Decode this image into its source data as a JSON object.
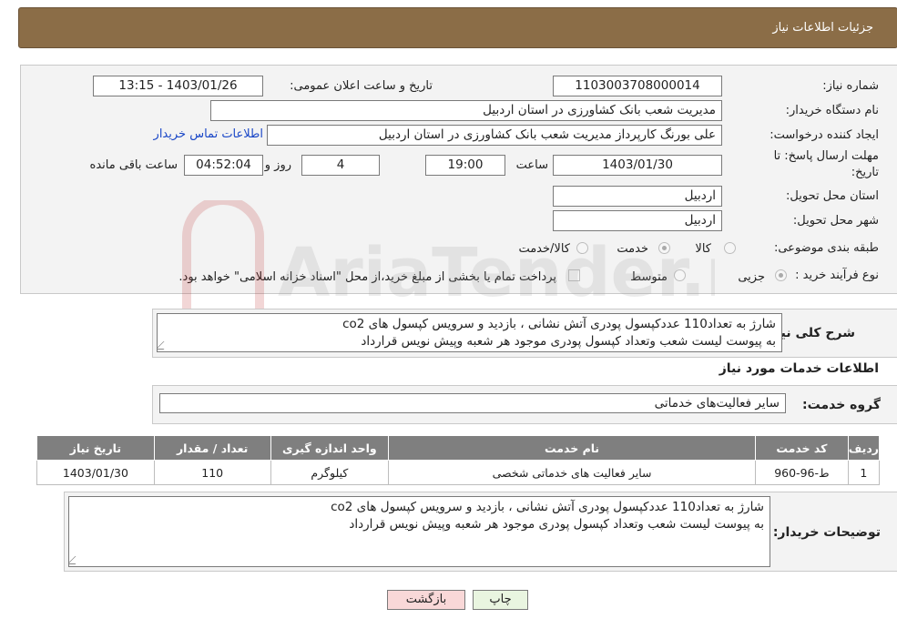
{
  "header": {
    "title": "جزئیات اطلاعات نیاز"
  },
  "form": {
    "need_number_label": "شماره نیاز:",
    "need_number": "1103003708000014",
    "announce_label": "تاریخ و ساعت اعلان عمومی:",
    "announce_value": "1403/01/26 - 13:15",
    "buyer_label": "نام دستگاه خریدار:",
    "buyer_value": "مدیریت شعب بانک کشاورزی در استان اردبیل",
    "creator_label": "ایجاد کننده درخواست:",
    "creator_value": "علی بورنگ کارپرداز مدیریت شعب بانک کشاورزی در استان اردبیل",
    "contact_link": "اطلاعات تماس خریدار",
    "deadline_label_1": "مهلت ارسال پاسخ: تا",
    "deadline_label_2": "تاریخ:",
    "deadline_date": "1403/01/30",
    "time_label": "ساعت",
    "deadline_time": "19:00",
    "days_value": "4",
    "days_label": "روز و",
    "remaining_value": "04:52:04",
    "remaining_label": "ساعت باقی مانده",
    "province_label": "استان محل تحویل:",
    "province_value": "اردبیل",
    "city_label": "شهر محل تحویل:",
    "city_value": "اردبیل",
    "category_label": "طبقه بندی موضوعی:",
    "category_options": [
      "کالا",
      "خدمت",
      "کالا/خدمت"
    ],
    "process_label": "نوع فرآیند خرید :",
    "process_options": [
      "جزیی",
      "متوسط"
    ],
    "process_note": "پرداخت تمام یا بخشی از مبلغ خرید،از محل \"اسناد خزانه اسلامی\" خواهد بود."
  },
  "summary": {
    "label": "شرح کلی نیاز:",
    "line1": "شارژ به تعداد110 عددکپسول پودری آتش نشانی ، بازدید و سرویس کپسول های co2",
    "line2": "به پیوست لیست شعب وتعداد کپسول پودری موجود هر شعبه وپیش نویس قرارداد"
  },
  "services": {
    "section_title": "اطلاعات خدمات مورد نیاز",
    "group_label": "گروه خدمت:",
    "group_value": "سایر فعالیت‌های خدماتی",
    "columns": [
      "ردیف",
      "کد خدمت",
      "نام خدمت",
      "واحد اندازه گیری",
      "تعداد / مقدار",
      "تاریخ نیاز"
    ],
    "rows": [
      [
        "1",
        "ط-96-960",
        "سایر فعالیت های خدماتی شخصی",
        "کیلوگرم",
        "110",
        "1403/01/30"
      ]
    ]
  },
  "buyer_notes": {
    "label": "توضیحات خریدار:",
    "line1": "شارژ به تعداد110 عددکپسول پودری آتش نشانی ، بازدید و سرویس کپسول های co2",
    "line2": "به پیوست لیست شعب وتعداد کپسول پودری موجود هر شعبه وپیش نویس قرارداد"
  },
  "buttons": {
    "print": "چاپ",
    "back": "بازگشت"
  },
  "watermark": {
    "text": "AriaTender.neT"
  },
  "colors": {
    "header": "#8b6d47",
    "link": "#1a47c7",
    "back_button": "#f9d8d8",
    "print_button": "#e9f5e0",
    "table_header": "#7f7f7f"
  }
}
